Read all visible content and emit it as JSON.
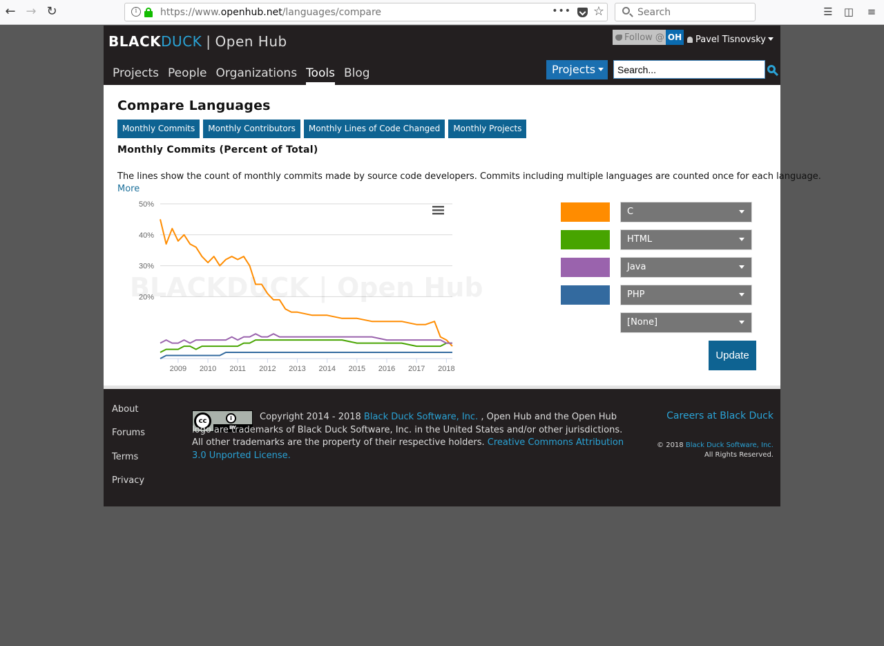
{
  "browser": {
    "url_prefix": "https://www.",
    "url_domain": "openhub.net",
    "url_path": "/languages/compare",
    "search_placeholder": "Search",
    "dots": "•••"
  },
  "header": {
    "logo_black": "BLACK",
    "logo_duck": "DUCK",
    "logo_sep": "|",
    "logo_openhub": "Open Hub",
    "follow_label": "Follow @",
    "follow_badge": "OH",
    "user_name": "Pavel Tisnovsky",
    "nav": [
      "Projects",
      "People",
      "Organizations",
      "Tools",
      "Blog"
    ],
    "active_nav": "Tools",
    "search_scope": "Projects",
    "search_value": "Search..."
  },
  "main": {
    "title": "Compare Languages",
    "tabs": [
      "Monthly Commits",
      "Monthly Contributors",
      "Monthly Lines of Code Changed",
      "Monthly Projects"
    ],
    "section_title": "Monthly Commits (Percent of Total)",
    "description": "The lines show the count of monthly commits made by source code developers. Commits including multiple languages are counted once for each language.",
    "more_label": "More",
    "languages": [
      {
        "name": "C",
        "color": "#ff8c00"
      },
      {
        "name": "HTML",
        "color": "#47a400"
      },
      {
        "name": "Java",
        "color": "#9a63ad"
      },
      {
        "name": "PHP",
        "color": "#336a9f"
      },
      {
        "name": "[None]",
        "color": ""
      }
    ],
    "update_label": "Update"
  },
  "chart_data": {
    "type": "line",
    "title": "",
    "xlabel": "",
    "ylabel": "",
    "ylim": [
      0,
      50
    ],
    "x_ticks": [
      "2009",
      "2010",
      "2011",
      "2012",
      "2013",
      "2014",
      "2015",
      "2016",
      "2017",
      "2018"
    ],
    "y_ticks": [
      "20%",
      "30%",
      "40%",
      "50%"
    ],
    "watermark": "BLACKDUCK | Open Hub",
    "x": [
      2008.4,
      2008.6,
      2008.8,
      2009.0,
      2009.2,
      2009.4,
      2009.6,
      2009.8,
      2010.0,
      2010.2,
      2010.4,
      2010.6,
      2010.8,
      2011.0,
      2011.2,
      2011.4,
      2011.6,
      2011.8,
      2012.0,
      2012.2,
      2012.4,
      2012.6,
      2012.8,
      2013.0,
      2013.5,
      2014.0,
      2014.5,
      2015.0,
      2015.5,
      2016.0,
      2016.5,
      2017.0,
      2017.3,
      2017.6,
      2017.8,
      2018.0,
      2018.2
    ],
    "series": [
      {
        "name": "C",
        "color": "#ff8c00",
        "values": [
          45,
          37,
          42,
          38,
          40,
          37,
          36,
          33,
          31,
          33,
          30,
          32,
          33,
          32,
          33,
          30,
          24,
          24,
          21,
          19,
          19,
          16,
          15,
          15,
          14,
          14,
          13,
          13,
          12,
          12,
          12,
          11,
          11,
          12,
          7,
          6,
          4
        ]
      },
      {
        "name": "HTML",
        "color": "#47a400",
        "values": [
          2,
          3,
          3,
          3,
          4,
          4,
          3,
          4,
          4,
          4,
          4,
          4,
          4,
          4,
          5,
          5,
          6,
          6,
          6,
          6,
          6,
          6,
          6,
          6,
          6,
          6,
          6,
          5,
          5,
          5,
          5,
          4,
          4,
          4,
          4,
          5,
          5
        ]
      },
      {
        "name": "Java",
        "color": "#9a63ad",
        "values": [
          5,
          6,
          5,
          5,
          6,
          5,
          6,
          6,
          6,
          6,
          6,
          6,
          7,
          6,
          7,
          7,
          8,
          7,
          7,
          8,
          7,
          7,
          7,
          7,
          7,
          7,
          7,
          7,
          7,
          6,
          6,
          6,
          6,
          6,
          6,
          5,
          5
        ]
      },
      {
        "name": "PHP",
        "color": "#336a9f",
        "values": [
          0,
          1,
          1,
          1,
          1,
          1,
          1,
          1,
          1,
          1,
          1,
          2,
          2,
          2,
          2,
          2,
          2,
          2,
          2,
          2,
          2,
          2,
          2,
          2,
          2,
          2,
          2,
          2,
          2,
          2,
          2,
          2,
          2,
          2,
          2,
          2,
          2
        ]
      }
    ]
  },
  "footer": {
    "links": [
      "About",
      "Forums",
      "Terms",
      "Privacy"
    ],
    "cc_badge": "cc",
    "cc_by": "BY",
    "copyright_pre": "Copyright 2014 - 2018 ",
    "copyright_company": "Black Duck Software, Inc.",
    "copyright_mid": " , Open Hub and the Open Hub logo are trademarks of Black Duck Software, Inc. in the United States and/or other jurisdictions. All other trademarks are the property of their respective holders. ",
    "copyright_license": "Creative Commons Attribution 3.0 Unported License.",
    "careers": "Careers at Black Duck",
    "small_copy_year": "© 2018 ",
    "small_copy_company": "Black Duck Software, Inc.",
    "small_copy_rights": "All Rights Reserved."
  }
}
